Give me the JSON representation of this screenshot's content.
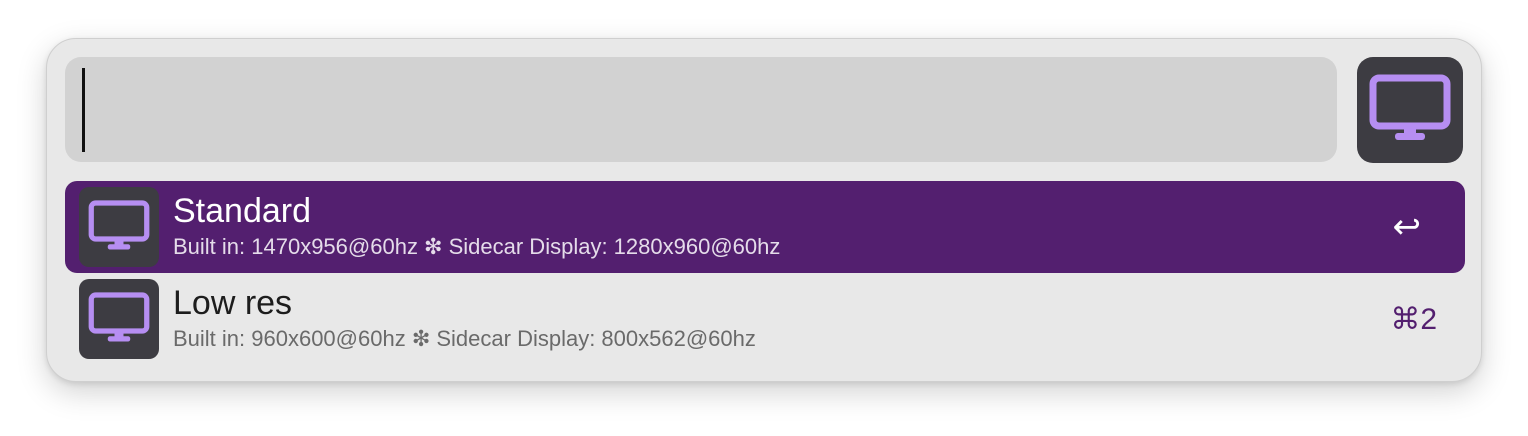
{
  "search": {
    "value": "",
    "placeholder": ""
  },
  "header": {
    "app_icon": "monitor-icon"
  },
  "colors": {
    "accent": "#531f6f",
    "icon_tile": "#3d3c42",
    "icon_glyph": "#b68ef2",
    "panel": "#e8e8e8",
    "search_field": "#d2d2d2"
  },
  "results": [
    {
      "title": "Standard",
      "subtitle": "Built in: 1470x956@60hz ❇ Sidecar Display: 1280x960@60hz",
      "shortcut": "↩",
      "icon": "monitor-icon",
      "selected": true
    },
    {
      "title": "Low res",
      "subtitle": "Built in: 960x600@60hz ❇ Sidecar Display: 800x562@60hz",
      "shortcut": "⌘2",
      "icon": "monitor-icon",
      "selected": false
    }
  ]
}
